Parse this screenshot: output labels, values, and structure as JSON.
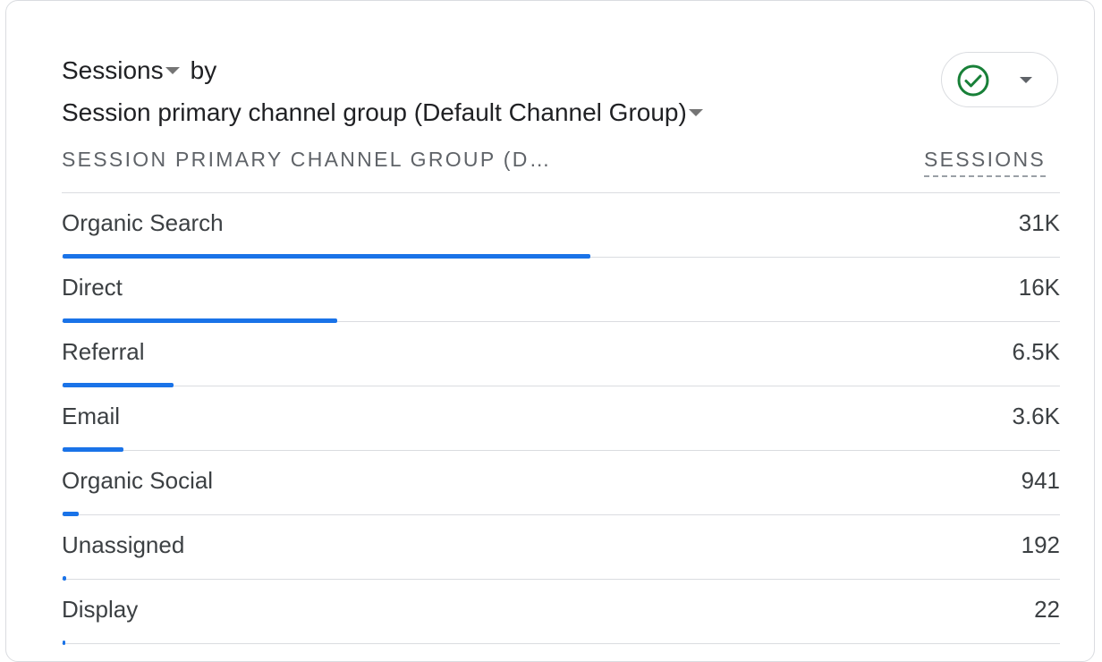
{
  "card": {
    "metric_label": "Sessions",
    "by_label": "by",
    "dimension_label": "Session primary channel group (Default Channel Group)",
    "status_icon": "check-circle-icon",
    "accent_color": "#1a73e8",
    "status_color": "#188038"
  },
  "table": {
    "dimension_header": "SESSION PRIMARY CHANNEL GROUP (D…",
    "metric_header": "SESSIONS",
    "rows": [
      {
        "label": "Organic Search",
        "value": "31K",
        "share": 1.0
      },
      {
        "label": "Direct",
        "value": "16K",
        "share": 0.52
      },
      {
        "label": "Referral",
        "value": "6.5K",
        "share": 0.21
      },
      {
        "label": "Email",
        "value": "3.6K",
        "share": 0.116
      },
      {
        "label": "Organic Social",
        "value": "941",
        "share": 0.031
      },
      {
        "label": "Unassigned",
        "value": "192",
        "share": 0.006
      },
      {
        "label": "Display",
        "value": "22",
        "share": 0.001
      }
    ]
  }
}
